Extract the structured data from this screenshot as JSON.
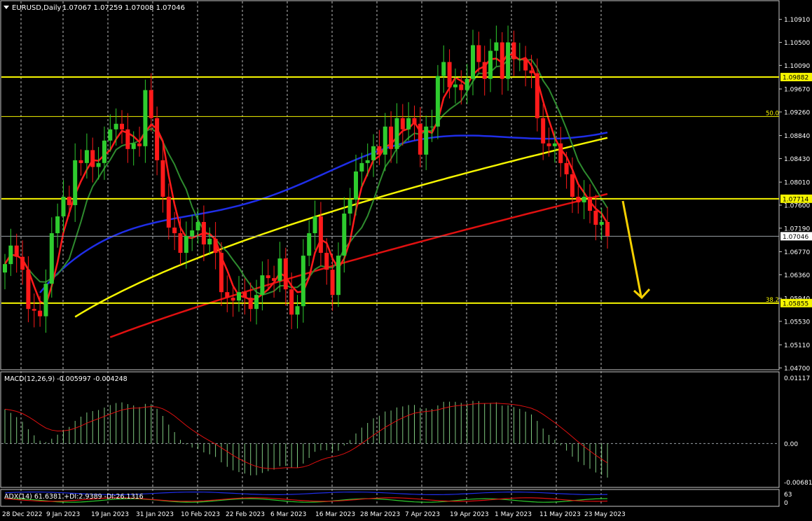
{
  "header": {
    "symbol": "EURUSD,Daily",
    "ohlc": "1.07067 1.07259 1.07008 1.07046"
  },
  "colors": {
    "background": "#000000",
    "bull": "#2ecc2e",
    "bear": "#ff1a1a",
    "grid": "#c8c8c8",
    "ma_fast_red": "#ff1a1a",
    "ma_fast_green": "#2e8b2e",
    "ma_50_blue": "#1f2ee8",
    "ma_100_yellow": "#f5f500",
    "ma_200_red": "#e01010",
    "level_line": "#f5f500",
    "arrow": "#f5d000",
    "last_price_line": "#9aa0a6",
    "macd_hist": "#7fc97f",
    "macd_signal": "#e01010",
    "adx": "#1f2ee8",
    "plus_di": "#2ecc2e",
    "minus_di": "#e01010"
  },
  "price_axis": {
    "labels": [
      "1.10910",
      "1.10500",
      "1.10090",
      "1.09670",
      "1.09260",
      "1.08840",
      "1.08430",
      "1.08010",
      "1.07600",
      "1.07190",
      "1.06770",
      "1.06360",
      "1.05940",
      "1.05530",
      "1.05110",
      "1.04700"
    ],
    "ylim": [
      1.0468,
      1.1123
    ]
  },
  "levels": [
    {
      "price": 1.09882,
      "tag": "1.09882",
      "fib": ""
    },
    {
      "price": 1.0918,
      "tag": "",
      "fib": "50.0"
    },
    {
      "price": 1.07714,
      "tag": "1.07714",
      "fib": ""
    },
    {
      "price": 1.05855,
      "tag": "1.05855",
      "fib": "38.2"
    }
  ],
  "last_price": {
    "price": 1.07046,
    "tag": "1.07046"
  },
  "date_labels": [
    "28 Dec 2022",
    "9 Jan 2023",
    "19 Jan 2023",
    "31 Jan 2023",
    "10 Feb 2023",
    "22 Feb 2023",
    "6 Mar 2023",
    "16 Mar 2023",
    "28 Mar 2023",
    "7 Apr 2023",
    "19 Apr 2023",
    "1 May 2023",
    "11 May 2023",
    "23 May 2023"
  ],
  "chart_data": [
    {
      "type": "candlestick",
      "series": [
        {
          "name": "",
          "close": [
            1.0655,
            1.0688,
            1.0668,
            1.0645,
            1.0575,
            1.0572,
            1.0562,
            1.062,
            1.071,
            1.074,
            1.0775,
            1.076,
            1.084,
            1.0835,
            1.0858,
            1.0828,
            1.0835,
            1.0875,
            1.0895,
            1.0905,
            1.0895,
            1.086,
            1.087,
            1.0865,
            1.0965,
            1.0915,
            1.084,
            1.0775,
            1.072,
            1.071,
            1.0675,
            1.0705,
            1.0715,
            1.073,
            1.069,
            1.07,
            1.0675,
            1.0605,
            1.0595,
            1.059,
            1.0605,
            1.0595,
            1.0575,
            1.06,
            1.0635,
            1.063,
            1.0625,
            1.0665,
            1.061,
            1.0565,
            1.058,
            1.067,
            1.071,
            1.074,
            1.0675,
            1.0645,
            1.06,
            1.067,
            1.0745,
            1.077,
            1.082,
            1.0835,
            1.084,
            1.0865,
            1.085,
            1.09,
            1.086,
            1.0915,
            1.0895,
            1.0915,
            1.0905,
            1.085,
            1.09,
            1.09,
            1.099,
            1.1015,
            1.097,
            1.0975,
            1.0965,
            1.0985,
            1.1045,
            1.1015,
            1.0985,
            1.1035,
            1.105,
            1.0985,
            1.105,
            1.102,
            1.102,
            1.1,
            1.0995,
            1.0915,
            1.087,
            1.0865,
            1.087,
            1.0835,
            1.0815,
            1.0775,
            1.0765,
            1.0775,
            1.075,
            1.0725,
            1.073,
            1.0705
          ]
        }
      ],
      "ylim": [
        1.0468,
        1.1123
      ]
    },
    {
      "type": "bar",
      "title": "MACD(12,26,9) -0.005997 -0.004248",
      "tick_labels": [
        "0.01117",
        "0.00",
        "-0.006814"
      ],
      "ylim": [
        -0.006814,
        0.01117
      ]
    },
    {
      "type": "line",
      "title": "ADX(14) 61.6381 +DI:2.9389 -DI:26.1316",
      "tick_labels": [
        "63",
        "0"
      ],
      "ylim": [
        0,
        63
      ]
    }
  ]
}
